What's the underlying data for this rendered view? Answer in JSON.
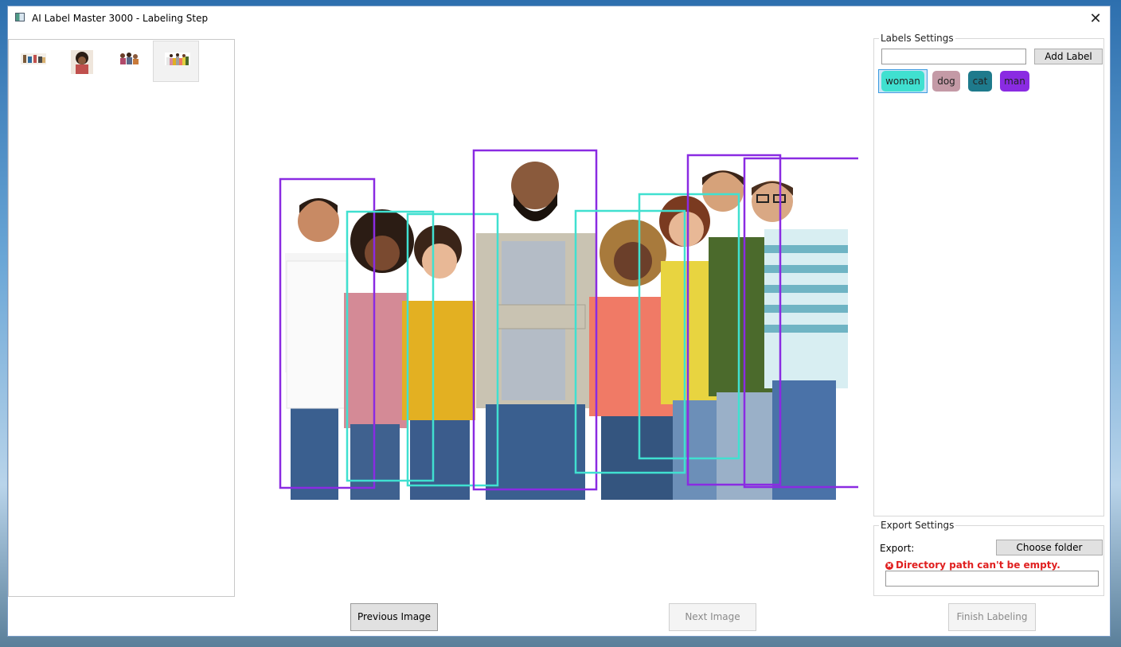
{
  "window": {
    "title": "AI Label Master 3000 - Labeling Step",
    "close_glyph": "✕"
  },
  "thumbnails": [
    {
      "name": "group-photo-thumbnail-1",
      "selected": false
    },
    {
      "name": "portrait-thumbnail-2",
      "selected": false
    },
    {
      "name": "family-thumbnail-3",
      "selected": false
    },
    {
      "name": "crowd-thumbnail-4",
      "selected": true
    }
  ],
  "labels_settings": {
    "group_title": "Labels Settings",
    "input_value": "",
    "add_button": "Add Label",
    "labels": [
      {
        "name": "woman",
        "color": "#40e0d0",
        "selected": true
      },
      {
        "name": "dog",
        "color": "#c49aa6",
        "selected": false
      },
      {
        "name": "cat",
        "color": "#1e7a8c",
        "selected": false
      },
      {
        "name": "man",
        "color": "#8a2be2",
        "selected": false
      }
    ]
  },
  "annotations": [
    {
      "label": "man"
    },
    {
      "label": "woman"
    },
    {
      "label": "woman"
    },
    {
      "label": "man"
    },
    {
      "label": "woman"
    },
    {
      "label": "woman"
    },
    {
      "label": "man"
    },
    {
      "label": "man"
    }
  ],
  "export_settings": {
    "group_title": "Export Settings",
    "export_label": "Export:",
    "choose_button": "Choose folder",
    "error_icon": "✖",
    "error_message": "Directory path can't be empty.",
    "path_value": ""
  },
  "navigation": {
    "previous": "Previous Image",
    "next": "Next Image",
    "finish": "Finish Labeling"
  }
}
